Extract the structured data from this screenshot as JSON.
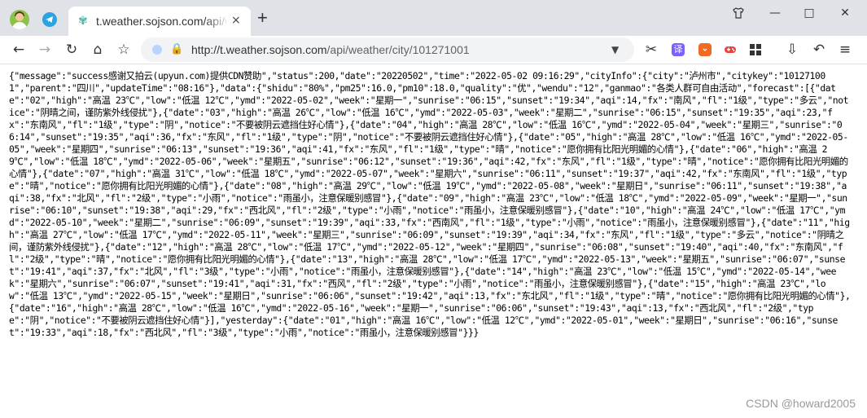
{
  "tab": {
    "title": "t.weather.sojson.com/api/we",
    "close_icon": "×"
  },
  "newtab_icon": "+",
  "window_controls": {
    "restore_icon": "⧉",
    "minimize_icon": "—",
    "maximize_icon": "□",
    "close_icon": "✕"
  },
  "toolbar": {
    "back_icon": "←",
    "forward_icon": "→",
    "reload_icon": "↻",
    "home_icon": "⌂",
    "star_icon": "☆",
    "url_host": "http://t.weather.sojson.com",
    "url_path": "/api/weather/city/101271001",
    "dropdown_icon": "▼",
    "ext1_icon": "✂",
    "ext2_label": "译",
    "ext3_icon": "🦁",
    "ext4_icon": "🎮",
    "ext5_icon": "▦",
    "download_icon": "⇩",
    "undo_icon": "↶",
    "menu_icon": "≡"
  },
  "response_text": "{\"message\":\"success感谢又拍云(upyun.com)提供CDN赞助\",\"status\":200,\"date\":\"20220502\",\"time\":\"2022-05-02 09:16:29\",\"cityInfo\":{\"city\":\"泸州市\",\"citykey\":\"101271001\",\"parent\":\"四川\",\"updateTime\":\"08:16\"},\"data\":{\"shidu\":\"80%\",\"pm25\":16.0,\"pm10\":18.0,\"quality\":\"优\",\"wendu\":\"12\",\"ganmao\":\"各类人群可自由活动\",\"forecast\":[{\"date\":\"02\",\"high\":\"高温 23℃\",\"low\":\"低温 12℃\",\"ymd\":\"2022-05-02\",\"week\":\"星期一\",\"sunrise\":\"06:15\",\"sunset\":\"19:34\",\"aqi\":14,\"fx\":\"南风\",\"fl\":\"1级\",\"type\":\"多云\",\"notice\":\"阴晴之间，谨防紫外线侵扰\"},{\"date\":\"03\",\"high\":\"高温 26℃\",\"low\":\"低温 16℃\",\"ymd\":\"2022-05-03\",\"week\":\"星期二\",\"sunrise\":\"06:15\",\"sunset\":\"19:35\",\"aqi\":23,\"fx\":\"东南风\",\"fl\":\"1级\",\"type\":\"阴\",\"notice\":\"不要被阴云遮挡住好心情\"},{\"date\":\"04\",\"high\":\"高温 28℃\",\"low\":\"低温 16℃\",\"ymd\":\"2022-05-04\",\"week\":\"星期三\",\"sunrise\":\"06:14\",\"sunset\":\"19:35\",\"aqi\":36,\"fx\":\"东风\",\"fl\":\"1级\",\"type\":\"阴\",\"notice\":\"不要被阴云遮挡住好心情\"},{\"date\":\"05\",\"high\":\"高温 28℃\",\"low\":\"低温 16℃\",\"ymd\":\"2022-05-05\",\"week\":\"星期四\",\"sunrise\":\"06:13\",\"sunset\":\"19:36\",\"aqi\":41,\"fx\":\"东风\",\"fl\":\"1级\",\"type\":\"晴\",\"notice\":\"愿你拥有比阳光明媚的心情\"},{\"date\":\"06\",\"high\":\"高温 29℃\",\"low\":\"低温 18℃\",\"ymd\":\"2022-05-06\",\"week\":\"星期五\",\"sunrise\":\"06:12\",\"sunset\":\"19:36\",\"aqi\":42,\"fx\":\"东风\",\"fl\":\"1级\",\"type\":\"晴\",\"notice\":\"愿你拥有比阳光明媚的心情\"},{\"date\":\"07\",\"high\":\"高温 31℃\",\"low\":\"低温 18℃\",\"ymd\":\"2022-05-07\",\"week\":\"星期六\",\"sunrise\":\"06:11\",\"sunset\":\"19:37\",\"aqi\":42,\"fx\":\"东南风\",\"fl\":\"1级\",\"type\":\"晴\",\"notice\":\"愿你拥有比阳光明媚的心情\"},{\"date\":\"08\",\"high\":\"高温 29℃\",\"low\":\"低温 19℃\",\"ymd\":\"2022-05-08\",\"week\":\"星期日\",\"sunrise\":\"06:11\",\"sunset\":\"19:38\",\"aqi\":38,\"fx\":\"北风\",\"fl\":\"2级\",\"type\":\"小雨\",\"notice\":\"雨虽小，注意保暖别感冒\"},{\"date\":\"09\",\"high\":\"高温 23℃\",\"low\":\"低温 18℃\",\"ymd\":\"2022-05-09\",\"week\":\"星期一\",\"sunrise\":\"06:10\",\"sunset\":\"19:38\",\"aqi\":29,\"fx\":\"西北风\",\"fl\":\"2级\",\"type\":\"小雨\",\"notice\":\"雨虽小，注意保暖别感冒\"},{\"date\":\"10\",\"high\":\"高温 24℃\",\"low\":\"低温 17℃\",\"ymd\":\"2022-05-10\",\"week\":\"星期二\",\"sunrise\":\"06:09\",\"sunset\":\"19:39\",\"aqi\":33,\"fx\":\"西南风\",\"fl\":\"1级\",\"type\":\"小雨\",\"notice\":\"雨虽小，注意保暖别感冒\"},{\"date\":\"11\",\"high\":\"高温 27℃\",\"low\":\"低温 17℃\",\"ymd\":\"2022-05-11\",\"week\":\"星期三\",\"sunrise\":\"06:09\",\"sunset\":\"19:39\",\"aqi\":34,\"fx\":\"东风\",\"fl\":\"1级\",\"type\":\"多云\",\"notice\":\"阴晴之间，谨防紫外线侵扰\"},{\"date\":\"12\",\"high\":\"高温 28℃\",\"low\":\"低温 17℃\",\"ymd\":\"2022-05-12\",\"week\":\"星期四\",\"sunrise\":\"06:08\",\"sunset\":\"19:40\",\"aqi\":40,\"fx\":\"东南风\",\"fl\":\"2级\",\"type\":\"晴\",\"notice\":\"愿你拥有比阳光明媚的心情\"},{\"date\":\"13\",\"high\":\"高温 28℃\",\"low\":\"低温 17℃\",\"ymd\":\"2022-05-13\",\"week\":\"星期五\",\"sunrise\":\"06:07\",\"sunset\":\"19:41\",\"aqi\":37,\"fx\":\"北风\",\"fl\":\"3级\",\"type\":\"小雨\",\"notice\":\"雨虽小，注意保暖别感冒\"},{\"date\":\"14\",\"high\":\"高温 23℃\",\"low\":\"低温 15℃\",\"ymd\":\"2022-05-14\",\"week\":\"星期六\",\"sunrise\":\"06:07\",\"sunset\":\"19:41\",\"aqi\":31,\"fx\":\"西风\",\"fl\":\"2级\",\"type\":\"小雨\",\"notice\":\"雨虽小，注意保暖别感冒\"},{\"date\":\"15\",\"high\":\"高温 23℃\",\"low\":\"低温 13℃\",\"ymd\":\"2022-05-15\",\"week\":\"星期日\",\"sunrise\":\"06:06\",\"sunset\":\"19:42\",\"aqi\":13,\"fx\":\"东北风\",\"fl\":\"1级\",\"type\":\"晴\",\"notice\":\"愿你拥有比阳光明媚的心情\"},{\"date\":\"16\",\"high\":\"高温 28℃\",\"low\":\"低温 16℃\",\"ymd\":\"2022-05-16\",\"week\":\"星期一\",\"sunrise\":\"06:06\",\"sunset\":\"19:43\",\"aqi\":13,\"fx\":\"西北风\",\"fl\":\"2级\",\"type\":\"阴\",\"notice\":\"不要被阴云遮挡住好心情\"}],\"yesterday\":{\"date\":\"01\",\"high\":\"高温 16℃\",\"low\":\"低温 12℃\",\"ymd\":\"2022-05-01\",\"week\":\"星期日\",\"sunrise\":\"06:16\",\"sunset\":\"19:33\",\"aqi\":18,\"fx\":\"西北风\",\"fl\":\"3级\",\"type\":\"小雨\",\"notice\":\"雨虽小，注意保暖别感冒\"}}}",
  "watermark": "CSDN @howard2005",
  "colors": {
    "titlebar_bg": "#dfe3e8",
    "urlbar_bg": "#f1f3f4",
    "ext_translate": "#7b61ff",
    "ext_brave": "#f06a24",
    "ext_game": "#e8433c"
  }
}
